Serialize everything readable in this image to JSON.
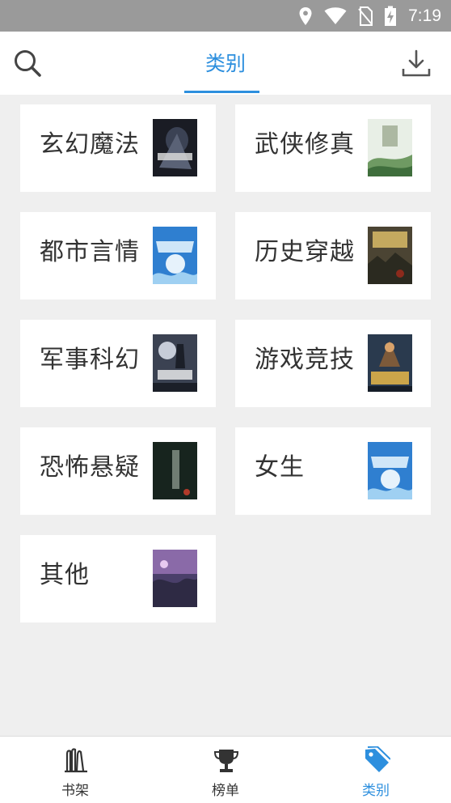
{
  "status": {
    "time": "7:19"
  },
  "header": {
    "title": "类别"
  },
  "categories": [
    {
      "label": "玄幻魔法",
      "cover": "cover-fantasy"
    },
    {
      "label": "武侠修真",
      "cover": "cover-wuxia"
    },
    {
      "label": "都市言情",
      "cover": "cover-urban"
    },
    {
      "label": "历史穿越",
      "cover": "cover-history"
    },
    {
      "label": "军事科幻",
      "cover": "cover-military"
    },
    {
      "label": "游戏竞技",
      "cover": "cover-game"
    },
    {
      "label": "恐怖悬疑",
      "cover": "cover-horror"
    },
    {
      "label": "女生",
      "cover": "cover-girls"
    },
    {
      "label": "其他",
      "cover": "cover-other"
    }
  ],
  "tabs": [
    {
      "label": "书架",
      "icon": "bookshelf-icon"
    },
    {
      "label": "榜单",
      "icon": "trophy-icon"
    },
    {
      "label": "类别",
      "icon": "tag-icon"
    }
  ],
  "colors": {
    "accent": "#2d8fde",
    "statusbar": "#9a9a9a",
    "background": "#efefef"
  }
}
